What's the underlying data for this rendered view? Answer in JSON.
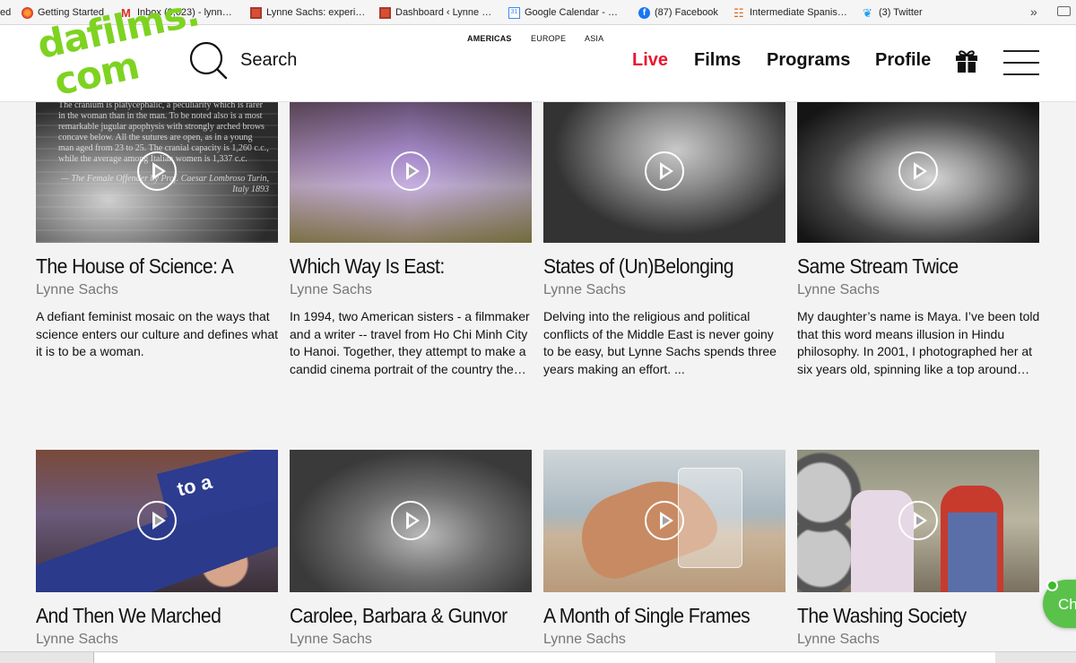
{
  "bookmarks": [
    {
      "label": "ed",
      "icon": "none"
    },
    {
      "label": "Getting Started",
      "icon": "firefox-icon"
    },
    {
      "label": "Inbox (8,623) - lynn…",
      "icon": "gmail-icon"
    },
    {
      "label": "Lynne Sachs: experi…",
      "icon": "site-icon"
    },
    {
      "label": "Dashboard ‹ Lynne …",
      "icon": "site-icon"
    },
    {
      "label": "Google Calendar - …",
      "icon": "calendar-icon"
    },
    {
      "label": "(87) Facebook",
      "icon": "facebook-icon"
    },
    {
      "label": "Intermediate Spanis…",
      "icon": "rss-icon"
    },
    {
      "label": "(3) Twitter",
      "icon": "twitter-icon"
    }
  ],
  "header": {
    "logo_line1": "dafilms.",
    "logo_line2": "com",
    "search_label": "Search",
    "regions": [
      "AMERICAS",
      "EUROPE",
      "ASIA"
    ],
    "nav": [
      "Live",
      "Films",
      "Programs",
      "Profile"
    ],
    "live_color": "#e8162f",
    "logo_color": "#7ed321"
  },
  "films": [
    {
      "title": "The House of Science: A",
      "author": "Lynne Sachs",
      "description": "A defiant feminist mosaic on the ways that science enters our culture and defines what it is to be a woman."
    },
    {
      "title": "Which Way Is East:",
      "author": "Lynne Sachs",
      "description": "In 1994, two American sisters - a filmmaker and a writer -- travel from Ho Chi Minh City to Hanoi. Together, they attempt to make a candid cinema portrait of the country the…"
    },
    {
      "title": "States of (Un)Belonging",
      "author": "Lynne Sachs",
      "description": "Delving into the religious and political conflicts of the Middle East is never goiny to be easy, but Lynne Sachs spends three years making an effort. ..."
    },
    {
      "title": "Same Stream Twice",
      "author": "Lynne Sachs",
      "description": "My daughter’s name is Maya. I’ve been told that this word means illusion in Hindu philosophy. In 2001, I photographed her at six years old, spinning like a top around…"
    },
    {
      "title": "And Then We Marched",
      "author": "Lynne Sachs",
      "description": ""
    },
    {
      "title": "Carolee, Barbara & Gunvor",
      "author": "Lynne Sachs",
      "description": ""
    },
    {
      "title": "A Month of Single Frames",
      "author": "Lynne Sachs",
      "description": ""
    },
    {
      "title": "The Washing Society",
      "author": "Lynne Sachs",
      "description": ""
    }
  ],
  "thumb_text": {
    "card1_caption": "The cranium is platycephalic, a peculiarity which is rarer in the woman than in the man. To be noted also is a most remarkable jugular apophysis with strongly arched brows concave below. All the sutures are open, as in a young man aged from 23 to 25. The cranial capacity is 1,260 c.c., while the average among Italian women is 1,337 c.c.",
    "card1_credit": "— The Female Offender by Prof. Caesar Lombroso Turin, Italy 1893",
    "card5_banner": "to a"
  },
  "chat": {
    "label": "Ch"
  }
}
